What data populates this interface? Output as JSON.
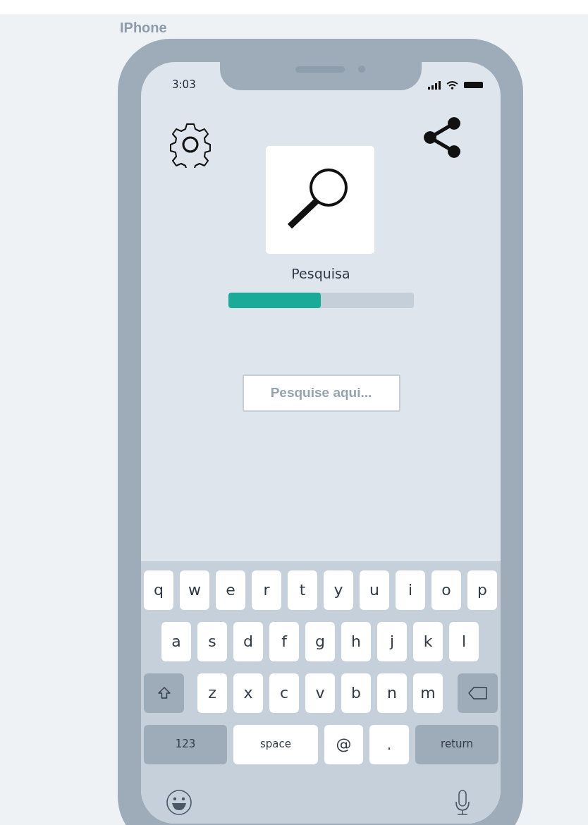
{
  "frame_label": "IPhone",
  "status_bar": {
    "time": "3:03"
  },
  "feature": {
    "title": "Pesquisa",
    "progress": {
      "level": 0.5
    }
  },
  "search": {
    "placeholder": "Pesquise aqui..."
  },
  "keyboard": {
    "rows": [
      {
        "keys": [
          {
            "kind": "char",
            "label": "q"
          },
          {
            "kind": "char",
            "label": "w"
          },
          {
            "kind": "char",
            "label": "e"
          },
          {
            "kind": "char",
            "label": "r"
          },
          {
            "kind": "char",
            "label": "t"
          },
          {
            "kind": "char",
            "label": "y"
          },
          {
            "kind": "char",
            "label": "u"
          },
          {
            "kind": "char",
            "label": "i"
          },
          {
            "kind": "char",
            "label": "o"
          },
          {
            "kind": "char",
            "label": "p"
          }
        ]
      },
      {
        "keys": [
          {
            "kind": "char",
            "label": "a"
          },
          {
            "kind": "char",
            "label": "s"
          },
          {
            "kind": "char",
            "label": "d"
          },
          {
            "kind": "char",
            "label": "f"
          },
          {
            "kind": "char",
            "label": "g"
          },
          {
            "kind": "char",
            "label": "h"
          },
          {
            "kind": "char",
            "label": "j"
          },
          {
            "kind": "char",
            "label": "k"
          },
          {
            "kind": "char",
            "label": "l"
          }
        ]
      },
      {
        "keys": [
          {
            "kind": "shift"
          },
          {
            "kind": "char",
            "label": "z"
          },
          {
            "kind": "char",
            "label": "x"
          },
          {
            "kind": "char",
            "label": "c"
          },
          {
            "kind": "char",
            "label": "v"
          },
          {
            "kind": "char",
            "label": "b"
          },
          {
            "kind": "char",
            "label": "n"
          },
          {
            "kind": "char",
            "label": "m"
          },
          {
            "kind": "backspace"
          }
        ]
      }
    ],
    "bottom_row": [
      {
        "kind": "mode",
        "label": "123"
      },
      {
        "kind": "wide",
        "label": "space"
      },
      {
        "kind": "char",
        "label": "@"
      },
      {
        "kind": "char",
        "label": "."
      },
      {
        "kind": "mode",
        "label": "return"
      }
    ]
  }
}
